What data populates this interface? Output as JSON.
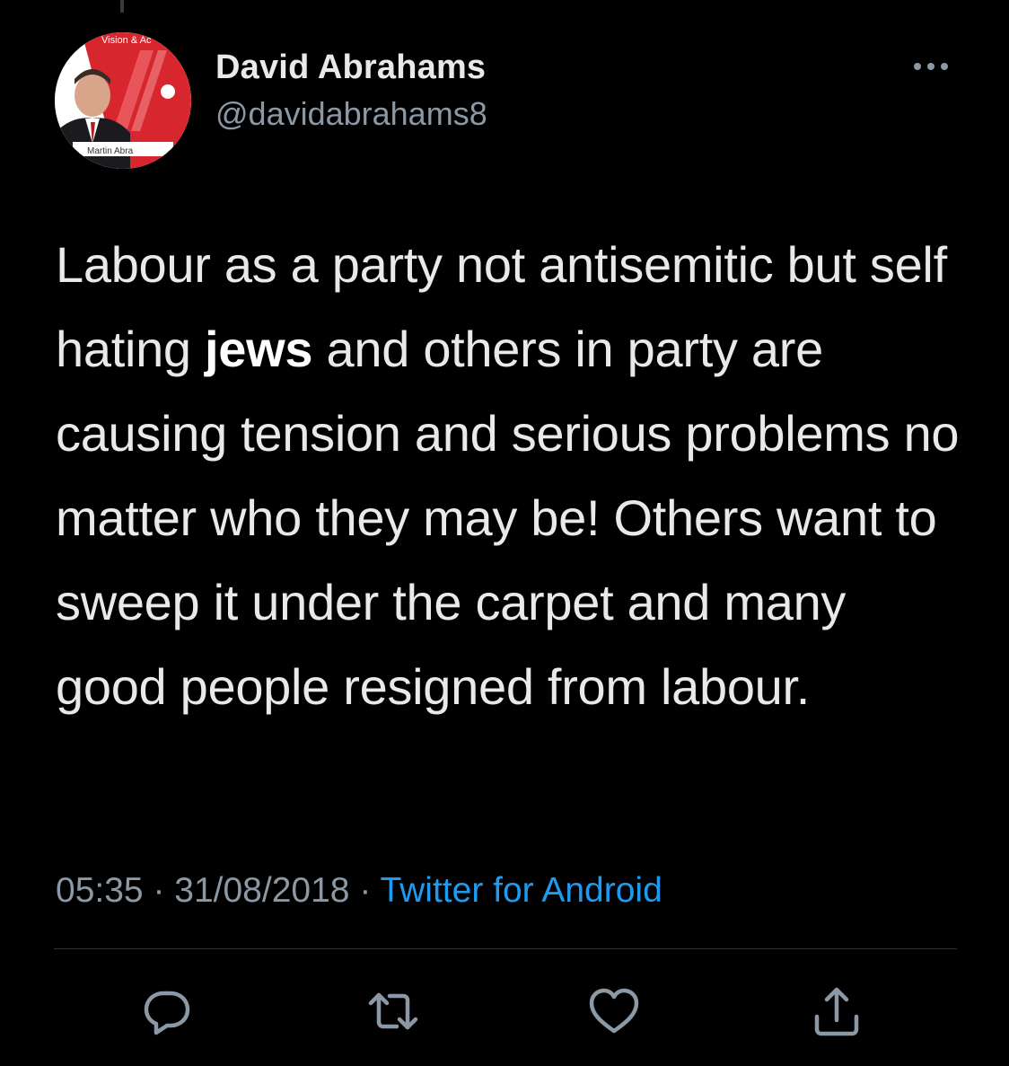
{
  "author": {
    "display_name": "David Abrahams",
    "handle": "@davidabrahams8",
    "avatar": {
      "top_text": "Vision & Ac",
      "bottom_text": "Martin Abra",
      "brand_color": "#d7262e"
    }
  },
  "tweet": {
    "text_before": "Labour as a party not antisemitic but self hating ",
    "text_highlight": "jews",
    "text_after": " and others in party are causing tension and serious problems no matter who they may be! Others want to sweep it under the carpet and many good people resigned from labour."
  },
  "meta": {
    "time": "05:35",
    "separator1": " · ",
    "date": "31/08/2018",
    "separator2": " · ",
    "source": "Twitter for Android"
  },
  "actions": [
    {
      "icon": "reply-icon"
    },
    {
      "icon": "retweet-icon"
    },
    {
      "icon": "like-icon"
    },
    {
      "icon": "share-icon"
    }
  ],
  "colors": {
    "background": "#000000",
    "text": "#e7e9ea",
    "secondary": "#8b98a5",
    "link": "#1d9bf0",
    "divider": "#2f3336"
  }
}
